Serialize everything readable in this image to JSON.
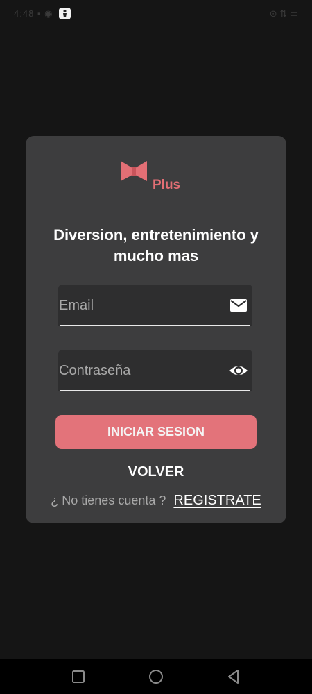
{
  "status_bar": {
    "left_text": "4:48 ▪ ◉",
    "right_text": "⊙ ⇅ ▭"
  },
  "logo": {
    "text": "Plus",
    "accent_color": "#e36f75"
  },
  "headline": "Diversion, entretenimiento y mucho mas",
  "email_field": {
    "placeholder": "Email",
    "icon": "mail-icon"
  },
  "password_field": {
    "placeholder": "Contraseña",
    "icon": "eye-icon"
  },
  "login_button": {
    "label": "INICIAR SESION",
    "color": "#e3737a"
  },
  "back_link": "VOLVER",
  "signup": {
    "prompt": "¿ No tienes cuenta ?",
    "link": "REGISTRATE"
  },
  "nav_bar": {
    "icons": [
      "recents-icon",
      "home-icon",
      "back-icon"
    ]
  }
}
